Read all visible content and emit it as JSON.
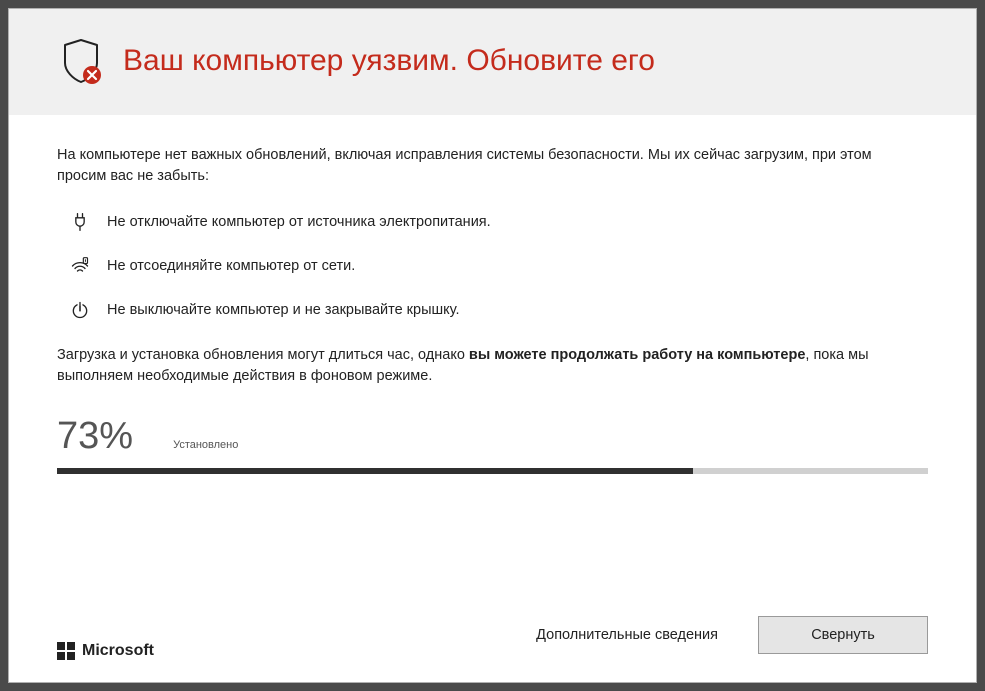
{
  "header": {
    "title": "Ваш компьютер уязвим. Обновите его"
  },
  "intro": "На компьютере нет важных обновлений, включая исправления системы безопасности. Мы их сейчас загрузим, при этом просим вас не забыть:",
  "tips": {
    "power": "Не отключайте компьютер от источника электропитания.",
    "network": "Не отсоединяйте компьютер от сети.",
    "shutdown": "Не выключайте компьютер и не закрывайте крышку."
  },
  "note": {
    "prefix": "Загрузка и установка обновления могут длиться час, однако ",
    "bold": "вы можете продолжать работу на компьютере",
    "suffix": ", пока мы выполняем необходимые действия в фоновом режиме."
  },
  "progress": {
    "percent_text": "73%",
    "percent_value": 73,
    "status": "Установлено"
  },
  "footer": {
    "more_info": "Дополнительные сведения",
    "minimize": "Свернуть",
    "logo_text": "Microsoft"
  }
}
